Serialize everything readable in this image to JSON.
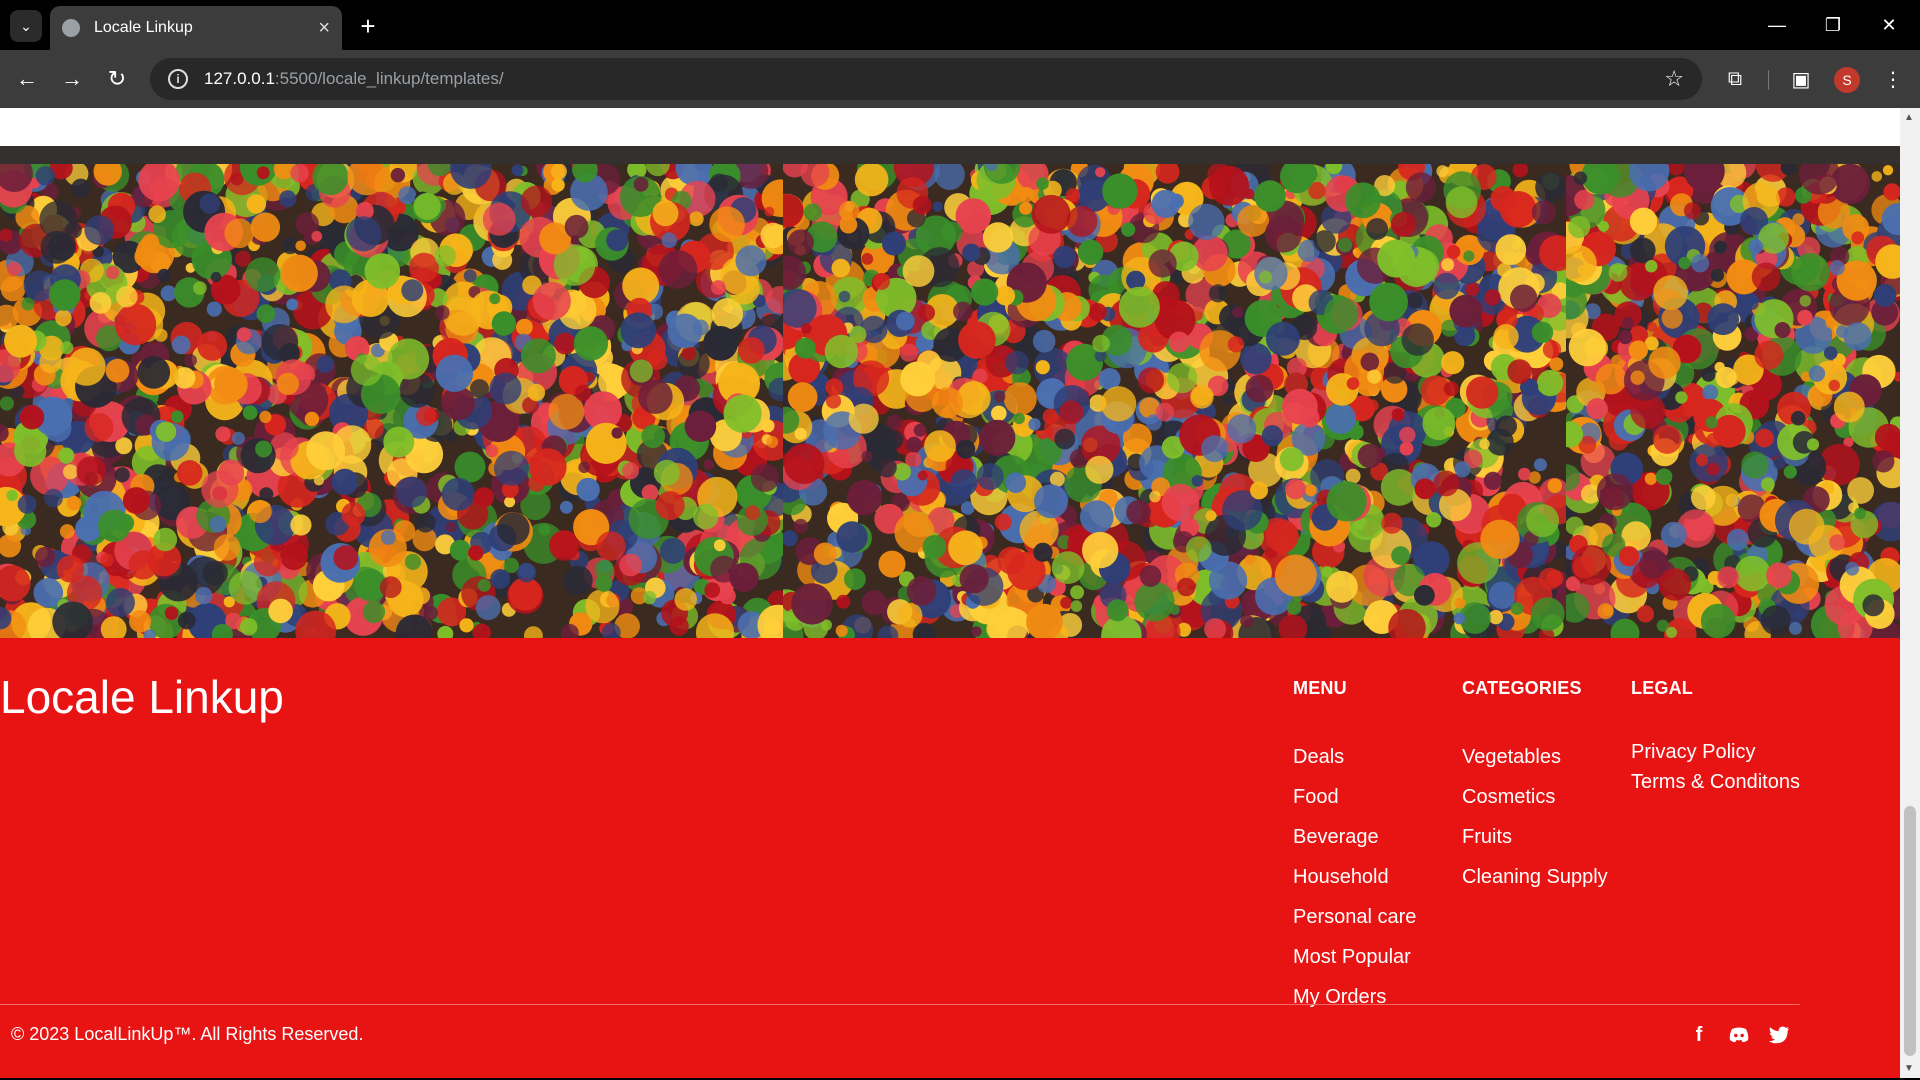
{
  "browser": {
    "tab_title": "Locale Linkup",
    "url_host": "127.0.0.1",
    "url_path": ":5500/locale_linkup/templates/",
    "profile_initial": "S"
  },
  "footer": {
    "brand": "Locale Linkup",
    "menu": {
      "heading": "MENU",
      "items": [
        "Deals",
        "Food",
        "Beverage",
        "Household",
        "Personal care",
        "Most Popular",
        "My Orders"
      ]
    },
    "categories": {
      "heading": "CATEGORIES",
      "items": [
        "Vegetables",
        "Cosmetics",
        "Fruits",
        "Cleaning Supply"
      ]
    },
    "legal": {
      "heading": "LEGAL",
      "items": [
        "Privacy Policy",
        "Terms & Conditons"
      ]
    },
    "copyright": "© 2023 LocalLinkUp™. All Rights Reserved.",
    "social": [
      "facebook-icon",
      "discord-icon",
      "twitter-icon"
    ]
  },
  "colors": {
    "footer_bg": "#e81414",
    "chrome_bg": "#000000",
    "toolbar_bg": "#3c3c3c"
  }
}
